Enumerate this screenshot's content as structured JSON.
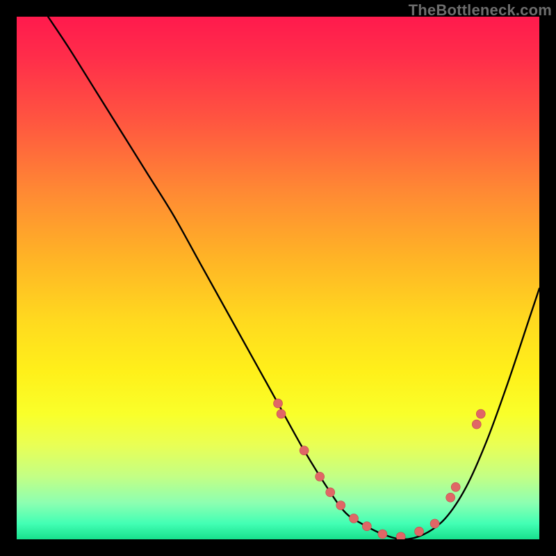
{
  "watermark": "TheBottleneck.com",
  "colors": {
    "background": "#000000",
    "curve": "#000000",
    "dots": "#e06666",
    "gradient_top": "#ff1a4d",
    "gradient_mid": "#fff01a",
    "gradient_bottom": "#18e08d"
  },
  "chart_data": {
    "type": "line",
    "title": "",
    "xlabel": "",
    "ylabel": "",
    "xlim": [
      0,
      100
    ],
    "ylim": [
      0,
      100
    ],
    "series": [
      {
        "name": "bottleneck-curve",
        "x": [
          6,
          10,
          15,
          20,
          25,
          30,
          35,
          40,
          45,
          50,
          55,
          60,
          63,
          66,
          70,
          74,
          78,
          82,
          86,
          90,
          94,
          98,
          100
        ],
        "y": [
          100,
          94,
          86,
          78,
          70,
          62,
          53,
          44,
          35,
          26,
          17,
          9,
          5,
          3,
          1,
          0,
          1,
          4,
          10,
          19,
          30,
          42,
          48
        ]
      }
    ],
    "highlight_points": {
      "name": "pink-dots",
      "x": [
        50,
        50.6,
        55,
        58,
        60,
        62,
        64.5,
        67,
        70,
        73.5,
        77,
        80,
        83,
        84,
        88,
        88.8
      ],
      "y": [
        26,
        24,
        17,
        12,
        9,
        6.5,
        4,
        2.5,
        1,
        0.5,
        1.5,
        3,
        8,
        10,
        22,
        24
      ]
    }
  }
}
